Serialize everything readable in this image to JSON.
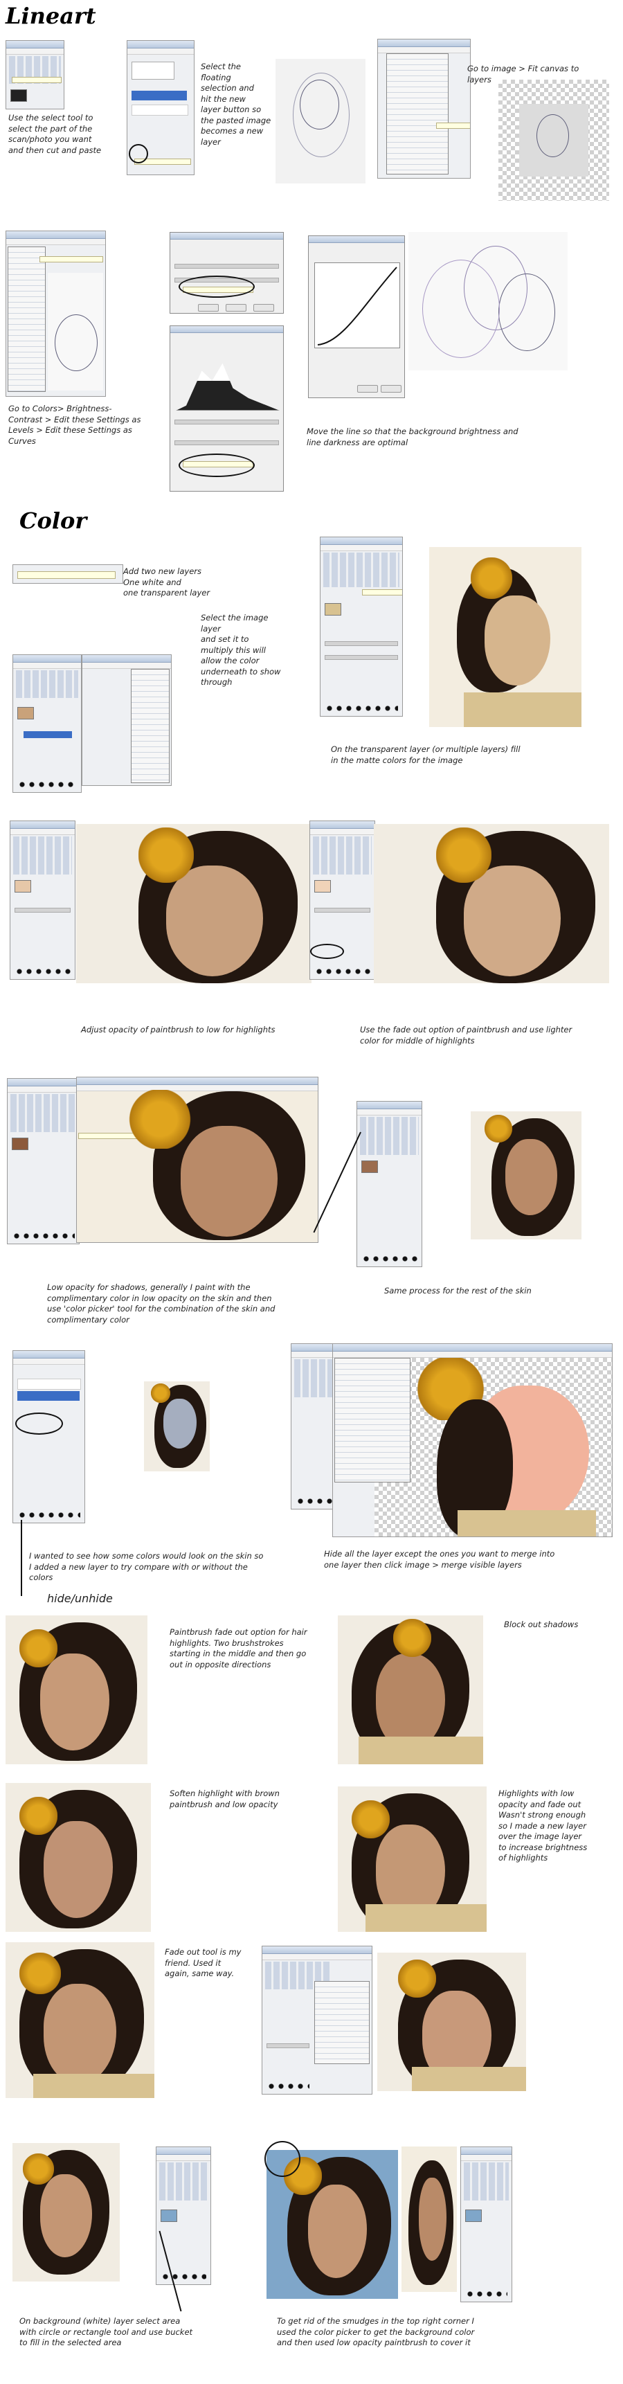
{
  "sections": {
    "lineart_title": "Lineart",
    "color_title": "Color"
  },
  "captions": {
    "c1": "Use the select tool to\nselect the part of the\nscan/photo you want\nand then cut and paste",
    "c2": "Select the\nfloating\nselection and\nhit the new\nlayer button so\nthe pasted image\nbecomes a new\nlayer",
    "c3": "Go to image > Fit canvas to\nlayers",
    "c4": "Go to Colors> Brightness-\nContrast > Edit these Settings as\nLevels > Edit these Settings as\nCurves",
    "c5": "Move the line so that the background brightness and\nline darkness are optimal",
    "c6": "Add two new layers\nOne white and\none transparent layer",
    "c7": "Select the image\nlayer\nand set it to\nmultiply this will\nallow the color\nunderneath to show\nthrough",
    "c8": "On the transparent layer (or multiple layers) fill\nin the matte colors for the image",
    "c9": "Adjust opacity of paintbrush to low for highlights",
    "c10": "Use the fade out option of paintbrush and use lighter\ncolor for middle of highlights",
    "c11": "Low opacity for shadows, generally I paint with the\ncomplimentary color  in low opacity on the skin and then\nuse 'color picker' tool for the combination of the skin and\ncomplimentary color",
    "c12": "Same process for the rest of the skin",
    "c13": "I wanted to see how some colors would look on the skin so\nI added a new layer to try compare with or without the\ncolors",
    "c14": "hide/unhide",
    "c15": "Hide all the layer except the ones you want to merge into\none layer then click image > merge visible layers",
    "c16": "Paintbrush fade out option for hair\nhighlights. Two brushstrokes\nstarting in the middle and then go\nout in opposite directions",
    "c17": "Block out shadows",
    "c18": "Soften highlight with brown\npaintbrush and low opacity",
    "c19": "Highlights with low\nopacity and fade out\nWasn't strong enough\nso I made a new layer\nover the image layer\nto increase brightness\nof highlights",
    "c20": "Fade out tool is my\nfriend. Used it\nagain, same way.",
    "c21": "On background (white) layer select area\nwith circle or rectangle tool and use bucket\nto fill in the selected area",
    "c22": "To get rid of the smudges in the top right corner I\nused the color picker to get the background color\nand then used low opacity paintbrush to cover it"
  },
  "colors": {
    "hair": "#231710",
    "skin": "#b98a68",
    "flower": "#e0a51e",
    "gown": "#d8c291",
    "background_sky": "#7fa6c9",
    "lineart_paper": "#f8f8f8",
    "toolbox_bg": "#eef0f3"
  },
  "icons": {
    "toolbox": "gimp-toolbox-icon",
    "brushes": "brush-dots-icon",
    "checker": "transparency-checker-icon"
  }
}
